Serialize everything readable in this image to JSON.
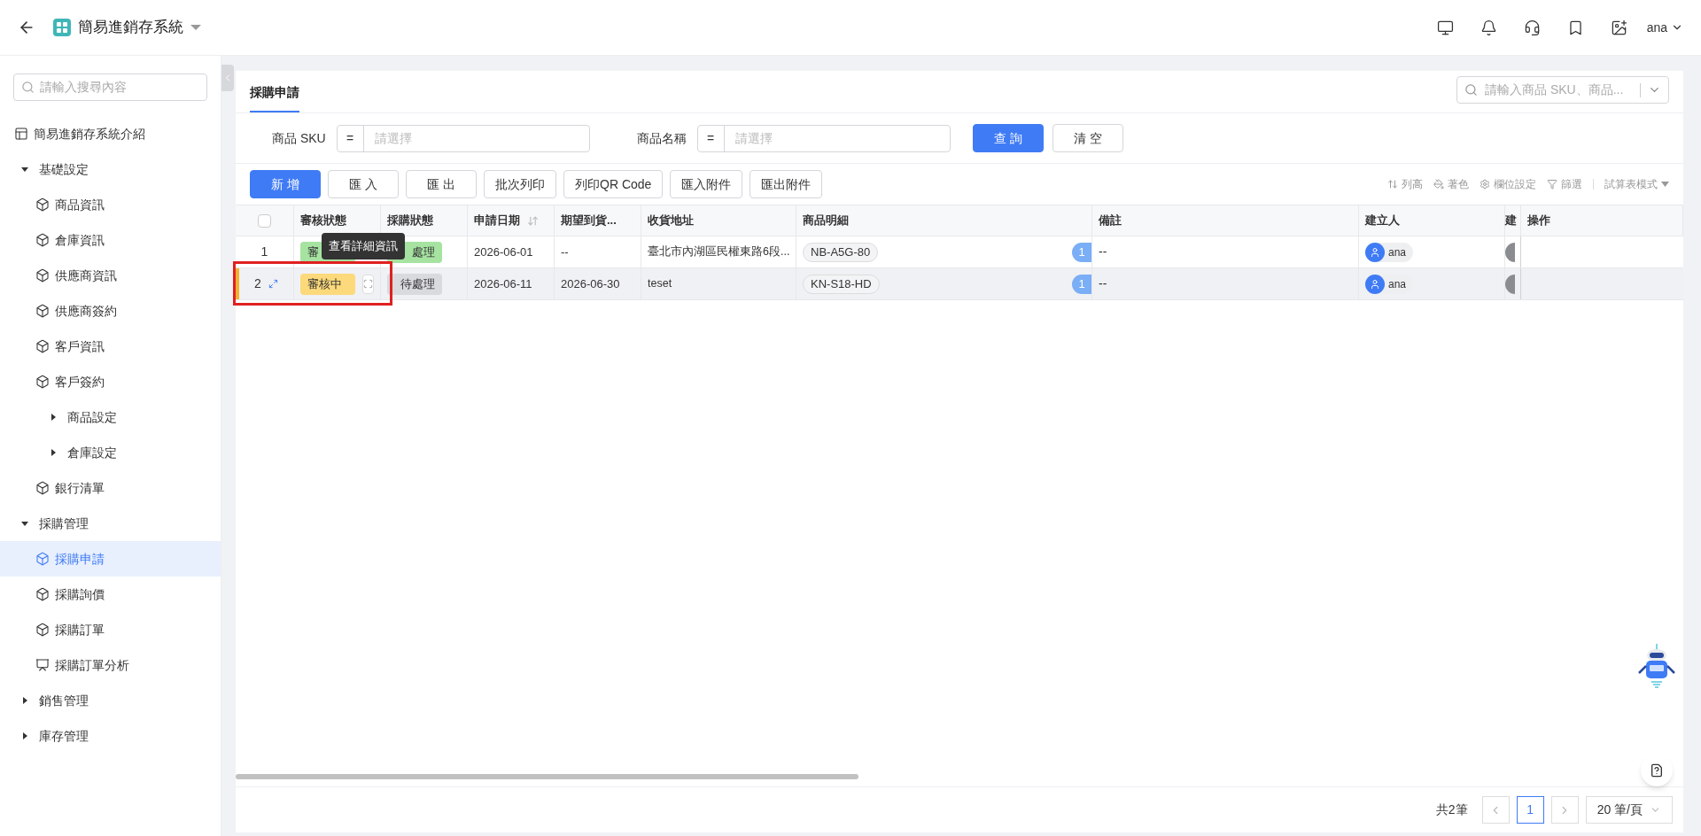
{
  "app": {
    "title": "簡易進銷存系統",
    "user": "ana"
  },
  "sidebar": {
    "search_placeholder": "請輸入搜尋內容",
    "items": [
      {
        "kind": "intro",
        "label": "簡易進銷存系統介紹",
        "selected": false
      },
      {
        "kind": "group",
        "label": "基礎設定",
        "expanded": true,
        "children": [
          {
            "kind": "page",
            "label": "商品資訊",
            "selected": false
          },
          {
            "kind": "page",
            "label": "倉庫資訊",
            "selected": false
          },
          {
            "kind": "page",
            "label": "供應商資訊",
            "selected": false
          },
          {
            "kind": "page",
            "label": "供應商簽約",
            "selected": false
          },
          {
            "kind": "page",
            "label": "客戶資訊",
            "selected": false
          },
          {
            "kind": "page",
            "label": "客戶簽約",
            "selected": false
          },
          {
            "kind": "group",
            "label": "商品設定",
            "expanded": false
          },
          {
            "kind": "group",
            "label": "倉庫設定",
            "expanded": false
          },
          {
            "kind": "page",
            "label": "銀行清單",
            "selected": false
          }
        ]
      },
      {
        "kind": "group",
        "label": "採購管理",
        "expanded": true,
        "children": [
          {
            "kind": "page",
            "label": "採購申請",
            "selected": true
          },
          {
            "kind": "page",
            "label": "採購詢價",
            "selected": false
          },
          {
            "kind": "page",
            "label": "採購訂單",
            "selected": false
          },
          {
            "kind": "analysis",
            "label": "採購訂單分析",
            "selected": false
          }
        ]
      },
      {
        "kind": "group",
        "label": "銷售管理",
        "expanded": false
      },
      {
        "kind": "group",
        "label": "庫存管理",
        "expanded": false
      }
    ]
  },
  "tabs": [
    {
      "label": "採購申請",
      "selected": true
    }
  ],
  "quick_search": {
    "placeholder": "請輸入商品 SKU、商品..."
  },
  "filters": [
    {
      "label": "商品 SKU",
      "operator": "=",
      "placeholder": "請選擇"
    },
    {
      "label": "商品名稱",
      "operator": "=",
      "placeholder": "請選擇"
    }
  ],
  "filter_buttons": [
    {
      "label": "查 詢",
      "primary": true
    },
    {
      "label": "清 空",
      "primary": false
    }
  ],
  "toolbar_buttons": [
    {
      "label": "新 增",
      "primary": true
    },
    {
      "label": "匯 入",
      "primary": false
    },
    {
      "label": "匯 出",
      "primary": false
    },
    {
      "label": "批次列印",
      "primary": false
    },
    {
      "label": "列印QR Code",
      "primary": false
    },
    {
      "label": "匯入附件",
      "primary": false
    },
    {
      "label": "匯出附件",
      "primary": false
    }
  ],
  "view_tools": [
    {
      "kind": "height",
      "label": "列高"
    },
    {
      "kind": "color",
      "label": "著色"
    },
    {
      "kind": "settings",
      "label": "欄位設定"
    },
    {
      "kind": "filter",
      "label": "篩選"
    },
    {
      "kind": "mode",
      "label": "試算表模式"
    }
  ],
  "table": {
    "select_all": {
      "checked": false
    },
    "columns": [
      "審核狀態",
      "採購狀態",
      "申請日期",
      "期望到貨...",
      "收貨地址",
      "商品明細",
      "備註",
      "建立人",
      "建",
      "操作"
    ],
    "rows": [
      {
        "index": "1",
        "selected": false,
        "review": {
          "label": "審",
          "color": "#a6e3a1"
        },
        "purchase": {
          "label": "處理",
          "color": "#a6e3a1"
        },
        "date": "2026-06-01",
        "expected": "--",
        "address": "臺北市內湖區民權東路6段...",
        "product": "NB-A5G-80",
        "product_count": "1",
        "note": "--",
        "creator": "ana"
      },
      {
        "index": "2",
        "selected": true,
        "review": {
          "label": "審核中",
          "color": "#fcd97a"
        },
        "purchase": {
          "label": "待處理",
          "color": "#d9dade"
        },
        "date": "2026-06-11",
        "expected": "2026-06-30",
        "address": "teset",
        "product": "KN-S18-HD",
        "product_count": "1",
        "note": "--",
        "creator": "ana"
      }
    ]
  },
  "tooltip": "查看詳細資訊",
  "pagination": {
    "total": "共2筆",
    "pages": [
      {
        "label": "1",
        "selected": true
      }
    ],
    "page_size": "20 筆/頁"
  }
}
